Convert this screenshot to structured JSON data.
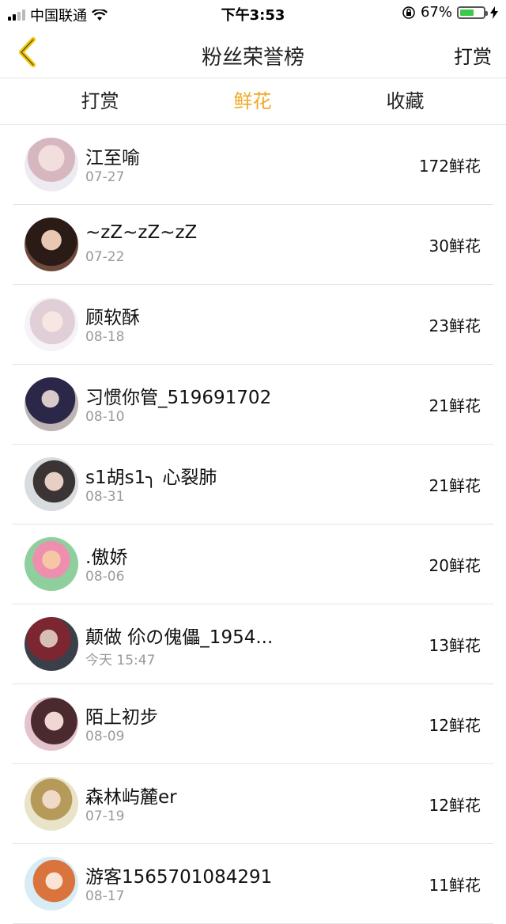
{
  "status": {
    "carrier": "中国联通",
    "time": "下午3:53",
    "battery_pct": "67%",
    "battery_level": 0.67
  },
  "nav": {
    "title": "粉丝荣誉榜",
    "right": "打赏"
  },
  "tabs": [
    {
      "label": "打赏",
      "active": false
    },
    {
      "label": "鲜花",
      "active": true
    },
    {
      "label": "收藏",
      "active": false
    }
  ],
  "colors": {
    "accent": "#f0a824",
    "date": "#9a9a9a",
    "divider": "#e3e3e3"
  },
  "fans": [
    {
      "name": "江至喻",
      "date": "07-27",
      "amount": "172鲜花"
    },
    {
      "name": "~zZ~zZ~zZ",
      "date": "07-22",
      "amount": "30鲜花"
    },
    {
      "name": "顾软酥",
      "date": "08-18",
      "amount": "23鲜花"
    },
    {
      "name": "习惯你管_519691702",
      "date": "08-10",
      "amount": "21鲜花"
    },
    {
      "name": "s1胡s1╮ 心裂肺",
      "date": "08-31",
      "amount": "21鲜花"
    },
    {
      "name": ".傲娇",
      "date": "08-06",
      "amount": "20鲜花"
    },
    {
      "name": "颠做 伱の傀儡_1954...",
      "date": "今天 15:47",
      "amount": "13鲜花"
    },
    {
      "name": "陌上初步",
      "date": "08-09",
      "amount": "12鲜花"
    },
    {
      "name": "森林屿麓er",
      "date": "07-19",
      "amount": "12鲜花"
    },
    {
      "name": "游客1565701084291",
      "date": "08-17",
      "amount": "11鲜花"
    }
  ]
}
